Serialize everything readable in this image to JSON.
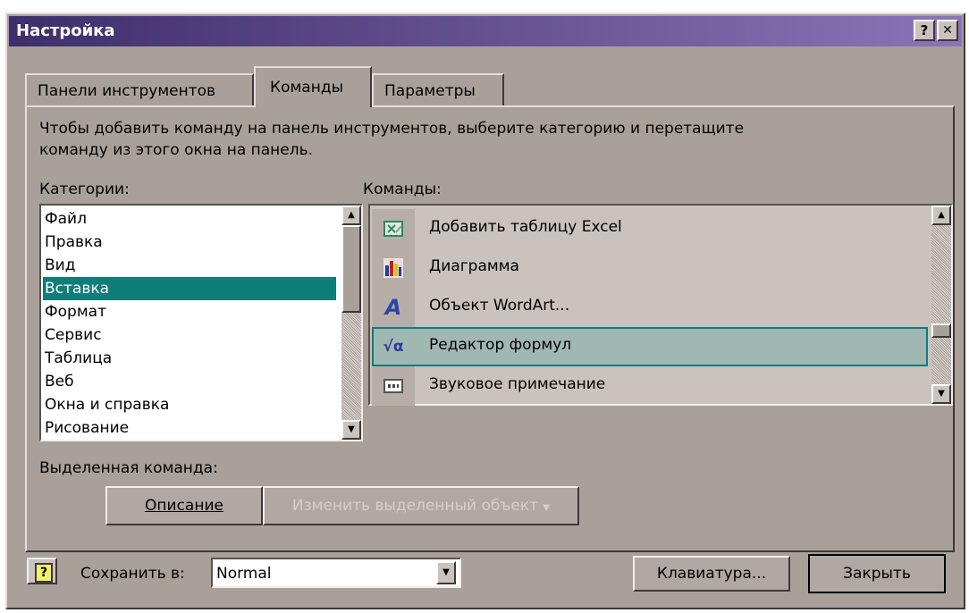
{
  "window": {
    "title": "Настройка",
    "help_button": "?",
    "close_button": "✕"
  },
  "tabs": [
    {
      "label": "Панели инструментов"
    },
    {
      "label": "Команды"
    },
    {
      "label": "Параметры"
    }
  ],
  "instructions": {
    "line1": "Чтобы добавить команду на панель инструментов, выберите категорию и перетащите",
    "line2": "команду из этого окна на панель."
  },
  "categories": {
    "label": "Категории:",
    "items": [
      "Файл",
      "Правка",
      "Вид",
      "Вставка",
      "Формат",
      "Сервис",
      "Таблица",
      "Веб",
      "Окна и справка",
      "Рисование"
    ],
    "selected": "Вставка"
  },
  "commands": {
    "label": "Команды:",
    "items": [
      {
        "label": "Добавить таблицу Excel",
        "icon": "excel-table-icon"
      },
      {
        "label": "Диаграмма",
        "icon": "chart-icon"
      },
      {
        "label": "Объект WordArt...",
        "icon": "wordart-icon"
      },
      {
        "label": "Редактор формул",
        "icon": "equation-editor-icon"
      },
      {
        "label": "Звуковое примечание",
        "icon": "sound-note-icon"
      }
    ],
    "selected": "Редактор формул"
  },
  "selected_command": {
    "label": "Выделенная команда:",
    "description_button": "Описание",
    "modify_button": "Изменить выделенный объект"
  },
  "footer": {
    "help_icon": "?",
    "save_in_label": "Сохранить в:",
    "save_in_value": "Normal",
    "keyboard_button": "Клавиатура...",
    "close_button": "Закрыть"
  },
  "colors": {
    "titlebar": "#3f2e6b",
    "selection": "#0f7d7a",
    "dialog": "#a9a09a"
  }
}
